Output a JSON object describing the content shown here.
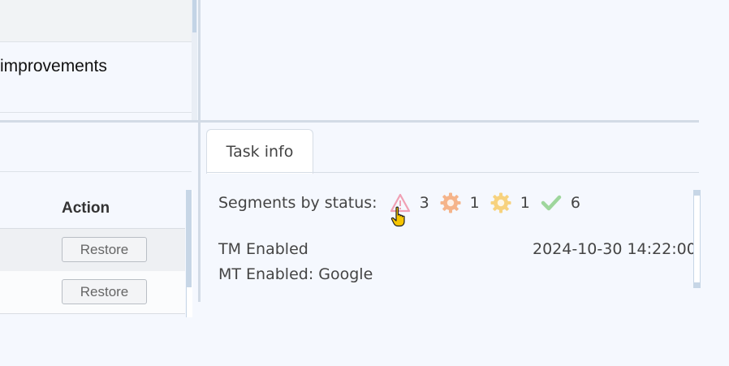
{
  "top_table": {
    "row_text": "improvements"
  },
  "history_table": {
    "column_action": "Action",
    "rows": [
      {
        "restore_label": "Restore"
      },
      {
        "restore_label": "Restore"
      }
    ]
  },
  "task_info": {
    "tab_label": "Task info",
    "segments_label": "Segments by status:",
    "statuses": [
      {
        "icon": "warning-triangle-icon",
        "count": "3",
        "color": "#f0a0b4"
      },
      {
        "icon": "gear-orange-icon",
        "count": "1",
        "color": "#f5b48a"
      },
      {
        "icon": "gear-yellow-icon",
        "count": "1",
        "color": "#f7d27e"
      },
      {
        "icon": "checkmark-icon",
        "count": "6",
        "color": "#9ed69c"
      }
    ],
    "tm_enabled": "TM Enabled",
    "mt_enabled": "MT Enabled: Google",
    "date": "2024-10-30 14:22:00"
  }
}
